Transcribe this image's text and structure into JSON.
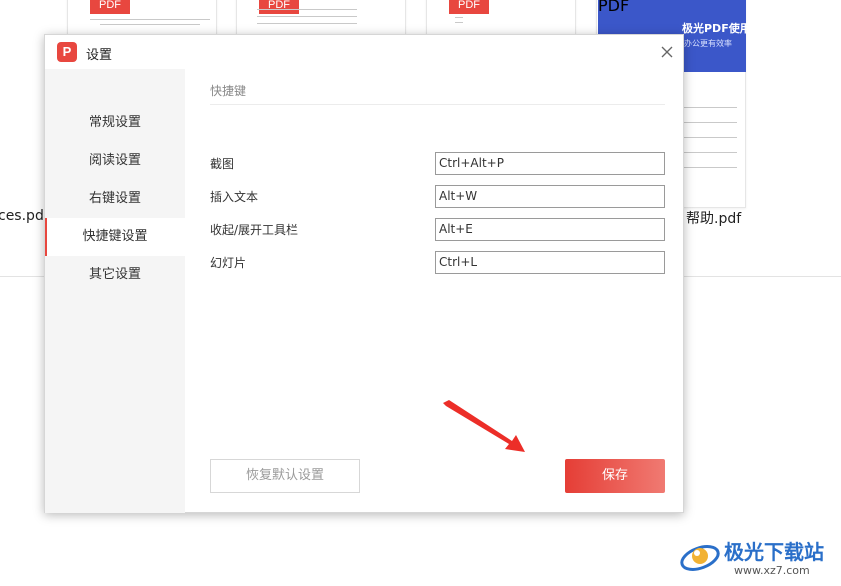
{
  "background": {
    "files": [
      {
        "tag": "PDF",
        "name": ""
      },
      {
        "tag": "PDF",
        "name": "ces.pdf"
      },
      {
        "tag": "PDF",
        "name": ""
      },
      {
        "tag": "PDF",
        "name": ""
      },
      {
        "tag": "PDF",
        "name": "帮助.pdf"
      }
    ],
    "cover_title": "极光PDF使用帮助",
    "cover_subtitle": "办公更有效率"
  },
  "dialog": {
    "title": "设置",
    "icons": {
      "app": "app-logo-icon",
      "close": "close-icon"
    },
    "sidebar": [
      {
        "label": "常规设置",
        "active": false
      },
      {
        "label": "阅读设置",
        "active": false
      },
      {
        "label": "右键设置",
        "active": false
      },
      {
        "label": "快捷键设置",
        "active": true
      },
      {
        "label": "其它设置",
        "active": false
      }
    ],
    "section_title": "快捷键",
    "shortcuts": [
      {
        "label": "截图",
        "value": "Ctrl+Alt+P"
      },
      {
        "label": "插入文本",
        "value": "Alt+W"
      },
      {
        "label": "收起/展开工具栏",
        "value": "Alt+E"
      },
      {
        "label": "幻灯片",
        "value": "Ctrl+L"
      }
    ],
    "reset_label": "恢复默认设置",
    "save_label": "保存"
  },
  "watermark": {
    "text": "极光下载站",
    "url": "www.xz7.com"
  },
  "colors": {
    "accent": "#e8473f",
    "cover": "#3b57c9",
    "watermark": "#2a6fc9"
  }
}
